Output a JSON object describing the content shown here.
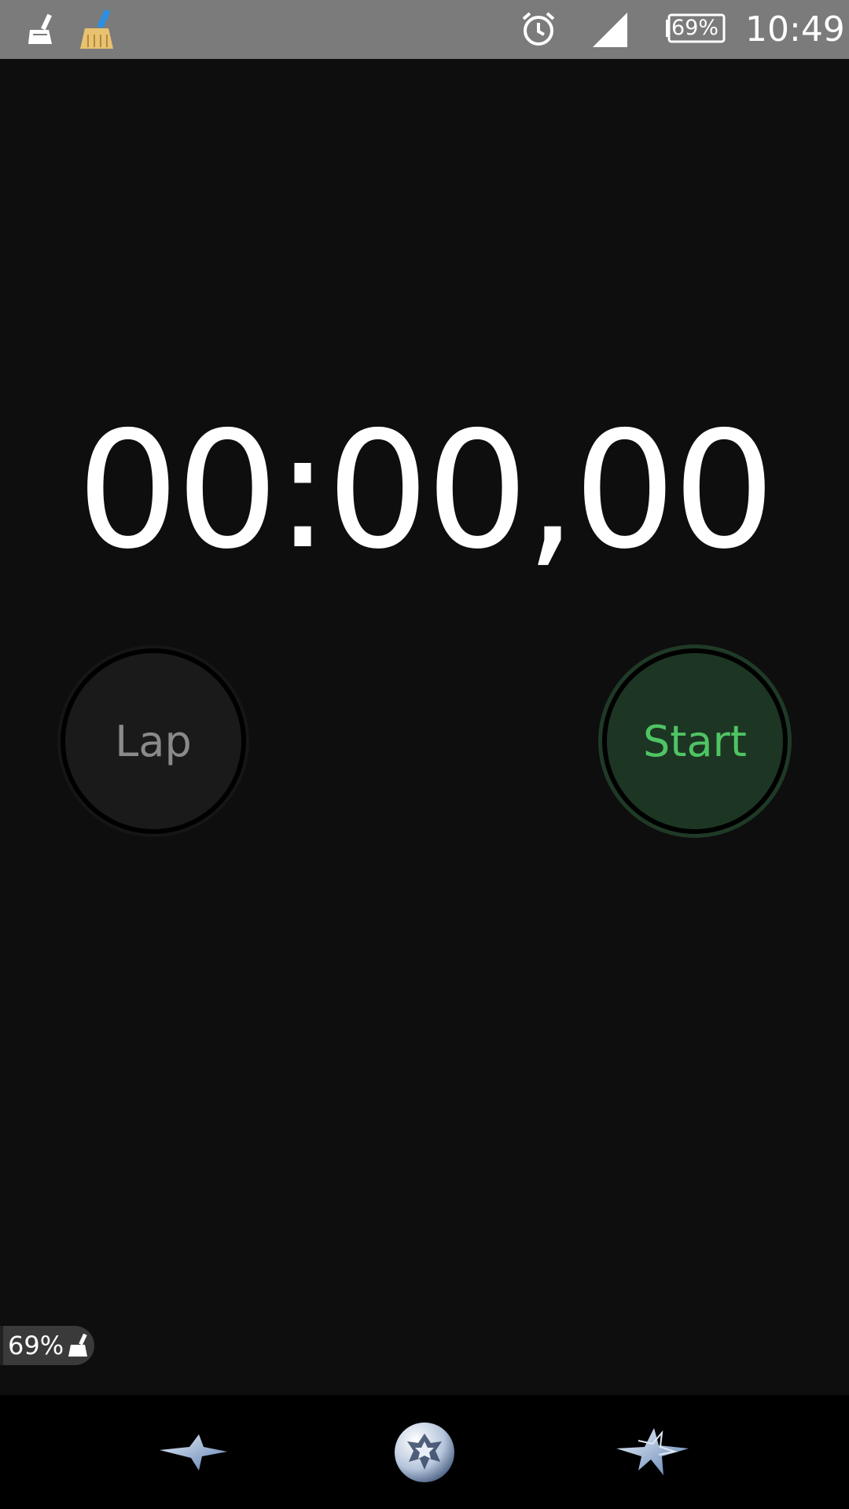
{
  "status_bar": {
    "battery_percent": "69%",
    "time": "10:49",
    "icons": [
      "broom-cleaner-icon",
      "clean-master-broom-icon",
      "alarm-clock-icon",
      "cell-signal-icon",
      "battery-icon"
    ]
  },
  "stopwatch": {
    "time": "00:00,00",
    "lap_label": "Lap",
    "start_label": "Start"
  },
  "floating_widget": {
    "battery_text": "69%",
    "icon": "broom-icon"
  },
  "nav_bar": {
    "back_icon": "star-back-icon",
    "home_icon": "football-home-icon",
    "recents_icon": "star-recents-icon"
  },
  "colors": {
    "status_bar_bg": "#7b7b7b",
    "screen_bg": "#0e0e0e",
    "start_text": "#4fc464",
    "start_bg": "#1c3623",
    "lap_text": "#8a8a8a"
  }
}
